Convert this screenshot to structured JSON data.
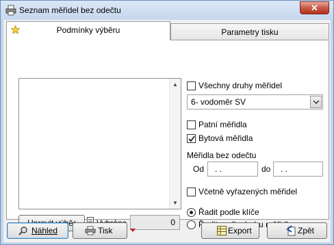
{
  "window": {
    "title": "Seznam měřidel bez odečtu",
    "close_label": "✕"
  },
  "tabs": [
    {
      "label": "Podmínky výběru",
      "active": true
    },
    {
      "label": "Parametry tisku",
      "active": false
    }
  ],
  "filters": {
    "all_meter_types_label": "Všechny druhy měřidel",
    "meter_type_selected": "6- vodoměr SV",
    "heel_meters_label": "Patní měřidla",
    "apartment_meters_label": "Bytová měřidla",
    "meters_without_reading_label": "Měřidla bez odečtu",
    "from_label": "Od",
    "from_value": " .  .",
    "to_label": "do",
    "to_value": " .  .",
    "include_removed_label": "Včetně vyřazených měřidel",
    "sort_by_key_label": "Řadit podle klíče",
    "sort_by_type_label": "Řadit podle druhu měřidla"
  },
  "selection": {
    "edit_button_label": "Upravit výběr",
    "selected_label": "Vybráno",
    "selected_count": "0"
  },
  "footer": {
    "preview_label": "Náhled",
    "print_label": "Tisk",
    "export_label": "Export",
    "back_label": "Zpět"
  },
  "colors": {
    "title_bar": "#c6d7ee",
    "close_button": "#c75a45",
    "frame": "#6e8db3"
  }
}
